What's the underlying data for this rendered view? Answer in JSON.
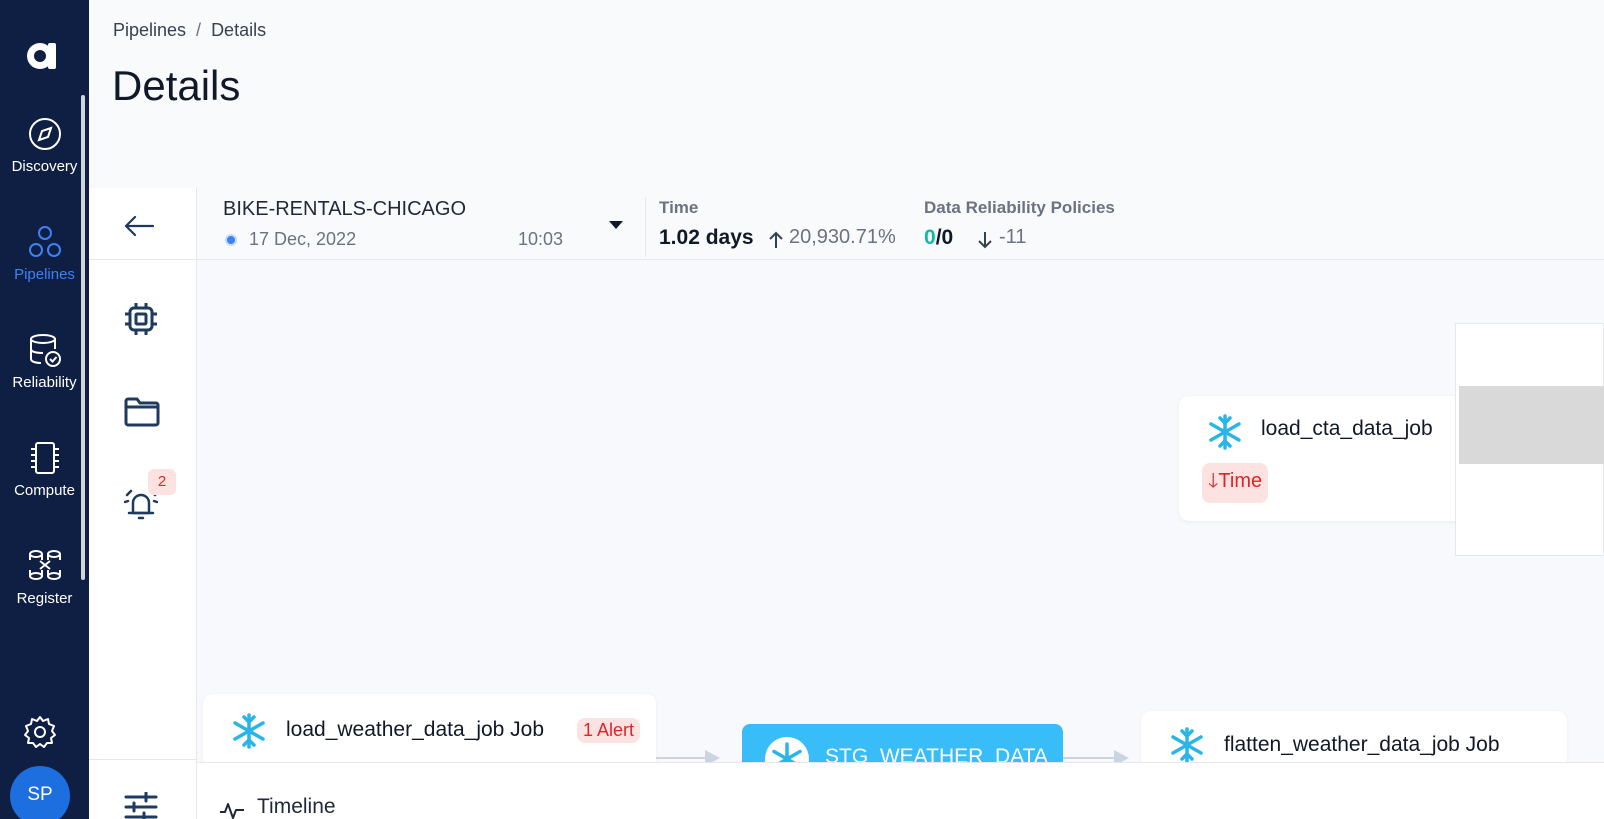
{
  "nav": {
    "logo": "a",
    "items": [
      {
        "label": "Discovery",
        "icon": "compass-icon"
      },
      {
        "label": "Pipelines",
        "icon": "pipelines-icon",
        "active": true
      },
      {
        "label": "Reliability",
        "icon": "database-check-icon"
      },
      {
        "label": "Compute",
        "icon": "chip-icon"
      },
      {
        "label": "Register",
        "icon": "register-icon"
      }
    ],
    "settings_icon": "gear-icon",
    "avatar_initials": "SP"
  },
  "breadcrumb": {
    "items": [
      "Pipelines",
      "Details"
    ],
    "separator": "/"
  },
  "page_title": "Details",
  "rail": {
    "alert_count": "2"
  },
  "pipeline": {
    "name": "BIKE-RENTALS-CHICAGO",
    "date": "17 Dec, 2022",
    "time": "10:03"
  },
  "metrics": {
    "time": {
      "label": "Time",
      "value": "1.02 days",
      "change": "20,930.71%",
      "direction": "up"
    },
    "policies": {
      "label": "Data Reliability Policies",
      "passed": "0",
      "total": "0",
      "change": "-11",
      "direction": "down"
    }
  },
  "nodes": {
    "cta_job": {
      "title": "load_cta_data_job",
      "tag": "Time"
    },
    "weather_job": {
      "title": "load_weather_data_job Job",
      "alert": "1 Alert"
    },
    "stg_weather": {
      "title": "STG_WEATHER_DATA"
    },
    "flatten_job": {
      "title": "flatten_weather_data_job Job"
    }
  },
  "timeline": {
    "label": "Timeline"
  },
  "colors": {
    "nav_bg": "#0f1f44",
    "active": "#3b82f6",
    "alert": "#dc2626",
    "snowflake": "#29b5e8",
    "teal": "#14b8a6"
  }
}
